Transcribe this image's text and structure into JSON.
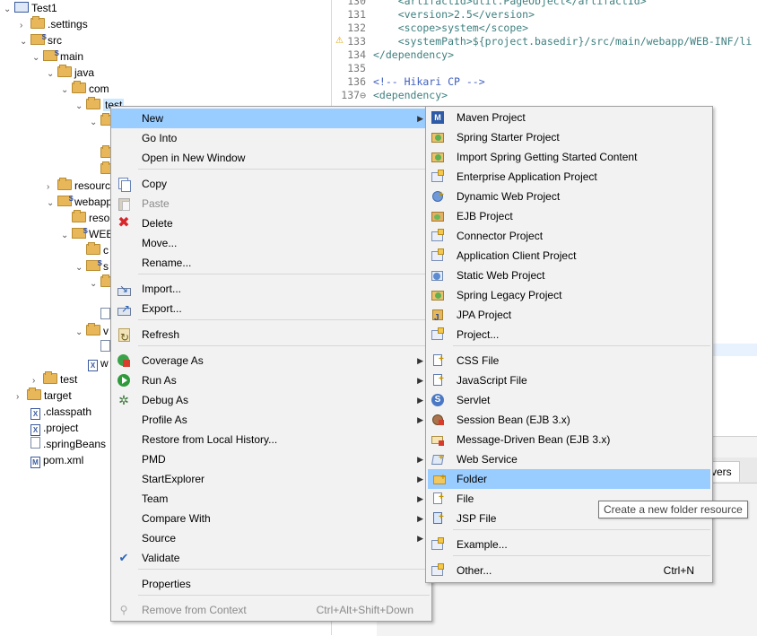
{
  "explorer": {
    "items": [
      {
        "label": "Test1"
      },
      {
        "label": ".settings"
      },
      {
        "label": "src"
      },
      {
        "label": "main"
      },
      {
        "label": "java"
      },
      {
        "label": "com"
      },
      {
        "label": "test"
      },
      {
        "label": "resourc"
      },
      {
        "label": "webapp"
      },
      {
        "label": "reso"
      },
      {
        "label": "WEB"
      },
      {
        "label": "c"
      },
      {
        "label": "s"
      },
      {
        "label": "v"
      },
      {
        "label": "w"
      },
      {
        "label": "test"
      },
      {
        "label": "target"
      },
      {
        "label": ".classpath"
      },
      {
        "label": ".project"
      },
      {
        "label": ".springBeans"
      },
      {
        "label": "pom.xml"
      }
    ]
  },
  "editor": {
    "lines": [
      {
        "num": "130",
        "text": "    <artifactId>util.PageObject</artifactId>"
      },
      {
        "num": "131",
        "text": "    <version>2.5</version>"
      },
      {
        "num": "132",
        "text": "    <scope>system</scope>"
      },
      {
        "num": "133",
        "text": "    <systemPath>${project.basedir}/src/main/webapp/WEB-INF/li"
      },
      {
        "num": "134",
        "text": "</dependency>"
      },
      {
        "num": "135",
        "text": ""
      },
      {
        "num": "136",
        "text": "<!-- Hikari CP -->"
      },
      {
        "num": "137⊖",
        "text": "<dependency>"
      }
    ],
    "bottom_tab_label": "vers"
  },
  "context_menu": {
    "items": [
      {
        "label": "New",
        "icon": "none",
        "submenu": true,
        "selected": true
      },
      {
        "label": "Go Into"
      },
      {
        "label": "Open in New Window"
      },
      {
        "label": "Copy",
        "icon": "copy-icon"
      },
      {
        "label": "Paste",
        "icon": "paste-icon",
        "disabled": true
      },
      {
        "label": "Delete",
        "icon": "delete-icon"
      },
      {
        "label": "Move..."
      },
      {
        "label": "Rename..."
      },
      {
        "label": "Import...",
        "icon": "import-icon"
      },
      {
        "label": "Export...",
        "icon": "export-icon"
      },
      {
        "label": "Refresh",
        "icon": "refresh-icon"
      },
      {
        "label": "Coverage As",
        "icon": "coverage-icon",
        "submenu": true
      },
      {
        "label": "Run As",
        "icon": "run-icon",
        "submenu": true
      },
      {
        "label": "Debug As",
        "icon": "debug-icon",
        "submenu": true
      },
      {
        "label": "Profile As",
        "submenu": true
      },
      {
        "label": "Restore from Local History..."
      },
      {
        "label": "PMD",
        "submenu": true
      },
      {
        "label": "StartExplorer",
        "submenu": true
      },
      {
        "label": "Team",
        "submenu": true
      },
      {
        "label": "Compare With",
        "submenu": true
      },
      {
        "label": "Source",
        "submenu": true
      },
      {
        "label": "Validate",
        "icon": "check-icon"
      },
      {
        "label": "Properties"
      },
      {
        "label": "Remove from Context",
        "accelerator": "Ctrl+Alt+Shift+Down",
        "disabled": true,
        "icon": "remove-context-icon"
      }
    ]
  },
  "new_submenu": {
    "items": [
      {
        "label": "Maven Project",
        "icon": "maven-project-icon"
      },
      {
        "label": "Spring Starter Project",
        "icon": "spring-starter-icon"
      },
      {
        "label": "Import Spring Getting Started Content",
        "icon": "spring-import-icon"
      },
      {
        "label": "Enterprise Application Project",
        "icon": "enterprise-app-icon"
      },
      {
        "label": "Dynamic Web Project",
        "icon": "dynamic-web-icon"
      },
      {
        "label": "EJB Project",
        "icon": "ejb-project-icon"
      },
      {
        "label": "Connector Project",
        "icon": "connector-project-icon"
      },
      {
        "label": "Application Client Project",
        "icon": "app-client-icon"
      },
      {
        "label": "Static Web Project",
        "icon": "static-web-icon"
      },
      {
        "label": "Spring Legacy Project",
        "icon": "spring-legacy-icon"
      },
      {
        "label": "JPA Project",
        "icon": "jpa-project-icon"
      },
      {
        "label": "Project...",
        "icon": "project-icon"
      },
      {
        "label": "CSS File",
        "icon": "css-file-icon"
      },
      {
        "label": "JavaScript File",
        "icon": "js-file-icon"
      },
      {
        "label": "Servlet",
        "icon": "servlet-icon"
      },
      {
        "label": "Session Bean (EJB 3.x)",
        "icon": "session-bean-icon"
      },
      {
        "label": "Message-Driven Bean (EJB 3.x)",
        "icon": "mdb-icon"
      },
      {
        "label": "Web Service",
        "icon": "web-service-icon"
      },
      {
        "label": "Folder",
        "icon": "folder-icon",
        "selected": true
      },
      {
        "label": "File",
        "icon": "file-icon"
      },
      {
        "label": "JSP File",
        "icon": "jsp-file-icon"
      },
      {
        "label": "Example...",
        "icon": "example-icon"
      },
      {
        "label": "Other...",
        "icon": "other-icon",
        "accelerator": "Ctrl+N"
      }
    ]
  },
  "tooltip": {
    "text": "Create a new folder resource"
  },
  "colors": {
    "selection": "#99ccff",
    "menu_bg": "#f2f2f2",
    "disabled_text": "#8a8a8a"
  }
}
